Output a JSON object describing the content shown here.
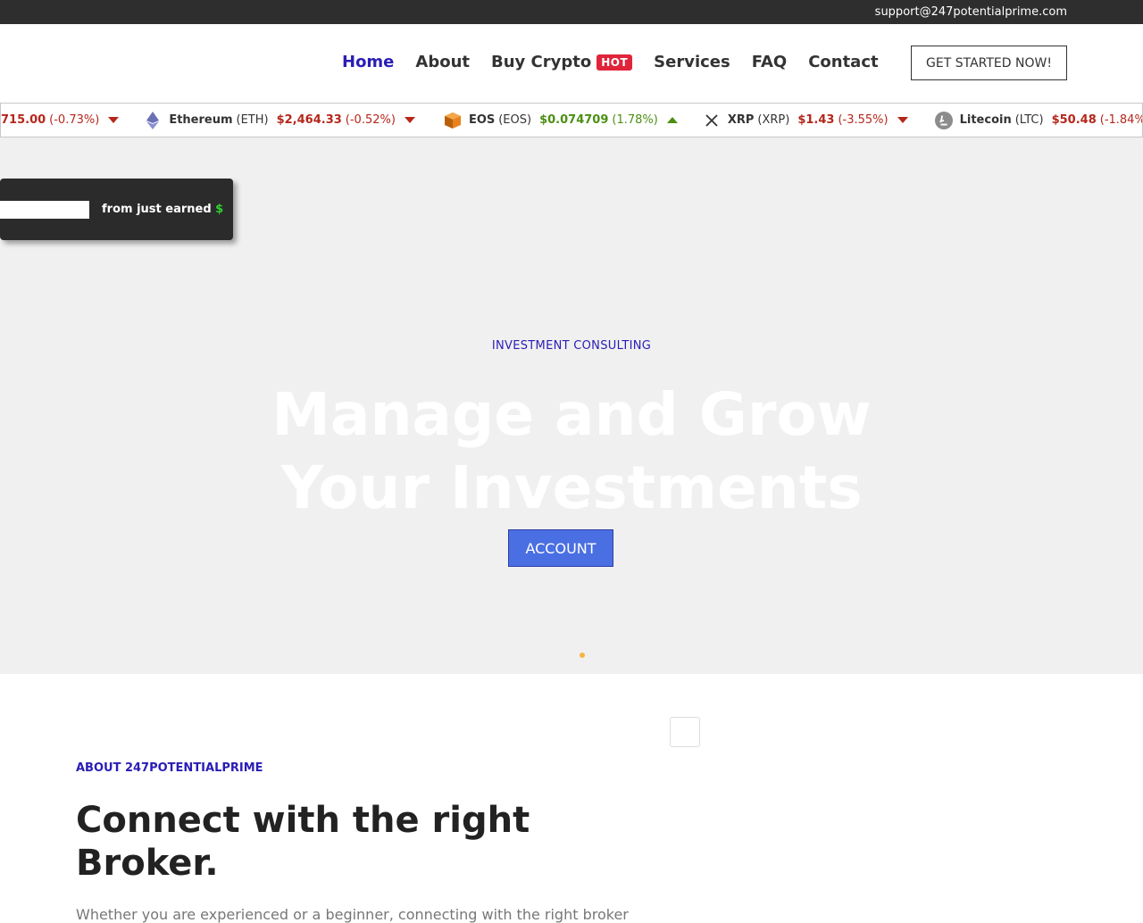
{
  "topbar": {
    "email": "support@247potentialprime.com"
  },
  "nav": {
    "items": [
      {
        "label": "Home",
        "active": true
      },
      {
        "label": "About"
      },
      {
        "label": "Buy Crypto",
        "badge": "HOT"
      },
      {
        "label": "Services"
      },
      {
        "label": "FAQ"
      },
      {
        "label": "Contact"
      }
    ],
    "cta": "GET STARTED NOW!"
  },
  "ticker": [
    {
      "name": "",
      "symbol": "",
      "price": "715.00",
      "change": "(-0.73%)",
      "direction": "down",
      "icon": ""
    },
    {
      "name": "Ethereum",
      "symbol": "(ETH)",
      "price": "$2,464.33",
      "change": "(-0.52%)",
      "direction": "down",
      "icon": "ethereum-icon"
    },
    {
      "name": "EOS",
      "symbol": "(EOS)",
      "price": "$0.074709",
      "change": "(1.78%)",
      "direction": "up",
      "icon": "eos-icon"
    },
    {
      "name": "XRP",
      "symbol": "(XRP)",
      "price": "$1.43",
      "change": "(-3.55%)",
      "direction": "down",
      "icon": "xrp-icon"
    },
    {
      "name": "Litecoin",
      "symbol": "(LTC)",
      "price": "$50.48",
      "change": "(-1.84%)",
      "direction": "down",
      "icon": "litecoin-icon"
    }
  ],
  "popup": {
    "text": "from just earned",
    "currency": "$"
  },
  "hero": {
    "kicker": "INVESTMENT CONSULTING",
    "title_line1": "Manage and Grow",
    "title_line2": "Your Investments",
    "button": "ACCOUNT"
  },
  "about": {
    "kicker": "ABOUT 247POTENTIALPRIME",
    "title": "Connect with the right Broker.",
    "text": "Whether you are experienced or a beginner, connecting with the right broker"
  },
  "colors": {
    "accent": "#2a1db5",
    "hot_badge": "#e0243a",
    "down": "#b5271b",
    "up": "#4b8f12",
    "button": "#4a6fe3"
  }
}
